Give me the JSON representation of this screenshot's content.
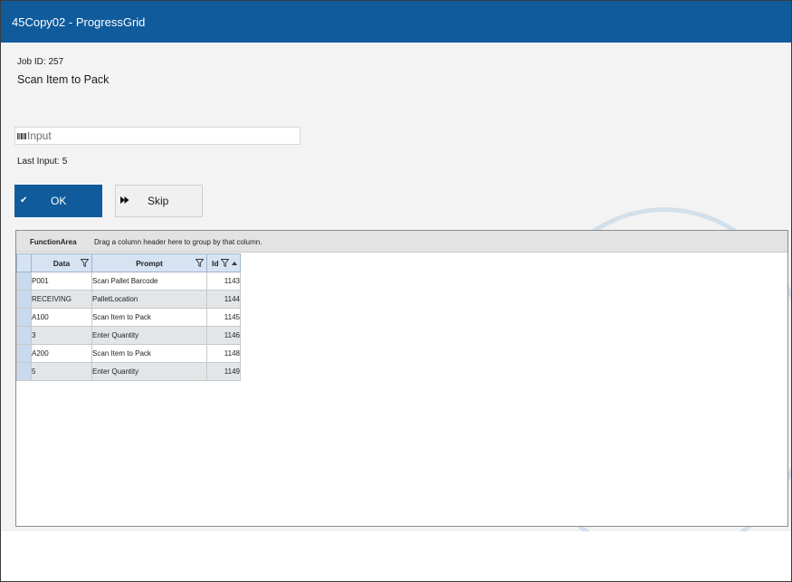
{
  "window": {
    "title": "45Copy02 - ProgressGrid"
  },
  "job": {
    "label": "Job ID:",
    "id": "257"
  },
  "prompt": "Scan Item to Pack",
  "input": {
    "placeholder": "Input",
    "value": "",
    "icon": "barcode-icon"
  },
  "last_input": {
    "label": "Last Input:",
    "value": "5"
  },
  "buttons": {
    "ok": {
      "label": "OK",
      "icon": "checkmark-icon"
    },
    "skip": {
      "label": "Skip",
      "icon": "fast-forward-icon"
    }
  },
  "grid": {
    "group_panel": {
      "title": "FunctionArea",
      "hint": "Drag a column header here to group by that column."
    },
    "columns": [
      {
        "label": "Data",
        "filter": true
      },
      {
        "label": "Prompt",
        "filter": true
      },
      {
        "label": "Id",
        "filter": true,
        "sorted": "ascending"
      }
    ],
    "rows": [
      {
        "data": "P001",
        "prompt": "Scan Pallet Barcode",
        "id": "1143"
      },
      {
        "data": "RECEIVING",
        "prompt": "PalletLocation",
        "id": "1144"
      },
      {
        "data": "A100",
        "prompt": "Scan Item to Pack",
        "id": "1145"
      },
      {
        "data": "3",
        "prompt": "Enter Quantity",
        "id": "1146"
      },
      {
        "data": "A200",
        "prompt": "Scan Item to Pack",
        "id": "1148"
      },
      {
        "data": "5",
        "prompt": "Enter Quantity",
        "id": "1149"
      }
    ]
  },
  "colors": {
    "accent": "#0f5b9c",
    "header": "#d6e3f3",
    "alt_row": "#e3e6e8"
  }
}
